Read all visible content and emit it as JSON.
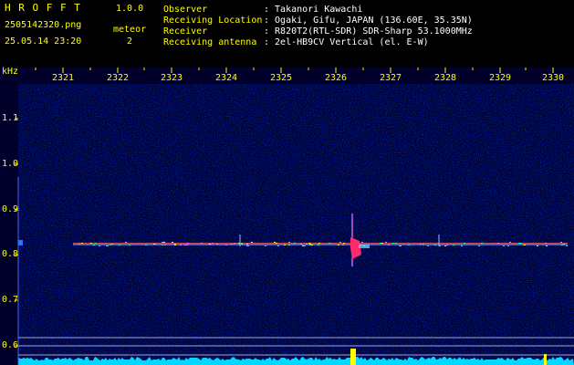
{
  "app": {
    "name": "H R O F F T",
    "version": "1.0.0"
  },
  "file": {
    "name": "2505142320.png",
    "datetime": "25.05.14 23:20"
  },
  "detection": {
    "label": "meteor",
    "count": "2"
  },
  "info": [
    {
      "key": "Observer",
      "value": ": Takanori Kawachi"
    },
    {
      "key": "Receiving Location",
      "value": ": Ogaki, Gifu, JAPAN (136.60E, 35.35N)"
    },
    {
      "key": "Receiver",
      "value": ": R820T2(RTL-SDR) SDR-Sharp 53.1000MHz"
    },
    {
      "key": "Receiving antenna",
      "value": ": 2el-HB9CV Vertical (el. E-W)"
    }
  ],
  "axis": {
    "unit": "kHz",
    "time_ticks": [
      "2321",
      "2322",
      "2323",
      "2324",
      "2325",
      "2326",
      "2327",
      "2328",
      "2329",
      "2330"
    ],
    "freq_ticks": [
      "1.1",
      "1.0",
      "0.9",
      "0.8",
      "0.7",
      "0.6"
    ]
  },
  "colors": {
    "label": "#ffff00",
    "text": "#ffffff",
    "background": "#000000"
  }
}
